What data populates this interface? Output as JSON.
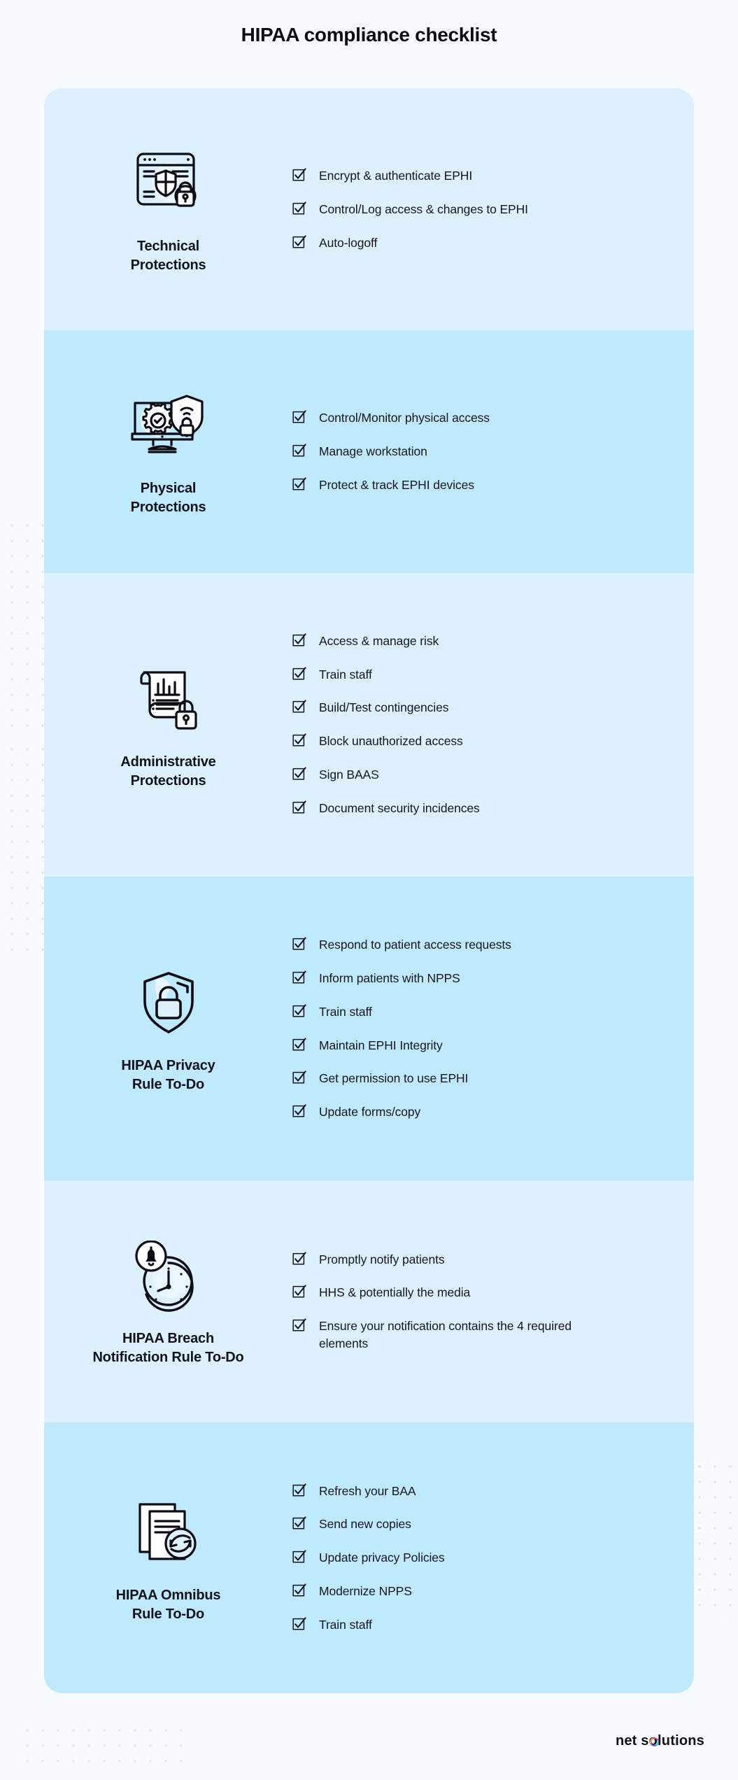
{
  "title": "HIPAA compliance checklist",
  "footer": {
    "brand_prefix": "net s",
    "brand_accent": "o",
    "brand_suffix": "lutions"
  },
  "colors": {
    "page_background": "#f8fbfd",
    "card_light": "#dcf1fd",
    "card_dark": "#bfeafd",
    "text": "#12121c",
    "dot_grid": "#d3dff0"
  },
  "sections": [
    {
      "icon": "browser-shield-lock-icon",
      "label": "Technical\nProtections",
      "shade": "light",
      "items": [
        "Encrypt & authenticate EPHI",
        "Control/Log access & changes to EPHI",
        "Auto-logoff"
      ]
    },
    {
      "icon": "monitor-gear-shield-wifi-lock-icon",
      "label": "Physical\nProtections",
      "shade": "dark",
      "items": [
        "Control/Monitor physical access",
        "Manage workstation",
        "Protect & track EPHI devices"
      ]
    },
    {
      "icon": "scroll-chart-lock-icon",
      "label": "Administrative\nProtections",
      "shade": "light",
      "items": [
        "Access & manage risk",
        "Train staff",
        "Build/Test contingencies",
        "Block unauthorized access",
        "Sign BAAS",
        "Document security incidences"
      ]
    },
    {
      "icon": "shield-padlock-icon",
      "label": "HIPAA Privacy\nRule To-Do",
      "shade": "dark",
      "items": [
        "Respond to patient access requests",
        "Inform patients with NPPS",
        "Train staff",
        "Maintain EPHI Integrity",
        "Get permission to use EPHI",
        "Update forms/copy"
      ]
    },
    {
      "icon": "clock-bell-alarm-icon",
      "label": "HIPAA Breach\nNotification Rule To-Do",
      "shade": "light",
      "items": [
        "Promptly notify patients",
        "HHS & potentially the media",
        "Ensure your notification contains the 4 required elements"
      ]
    },
    {
      "icon": "documents-refresh-icon",
      "label": "HIPAA Omnibus\nRule To-Do",
      "shade": "dark",
      "items": [
        "Refresh your BAA",
        "Send new copies",
        "Update privacy Policies",
        "Modernize NPPS",
        "Train staff"
      ]
    }
  ]
}
